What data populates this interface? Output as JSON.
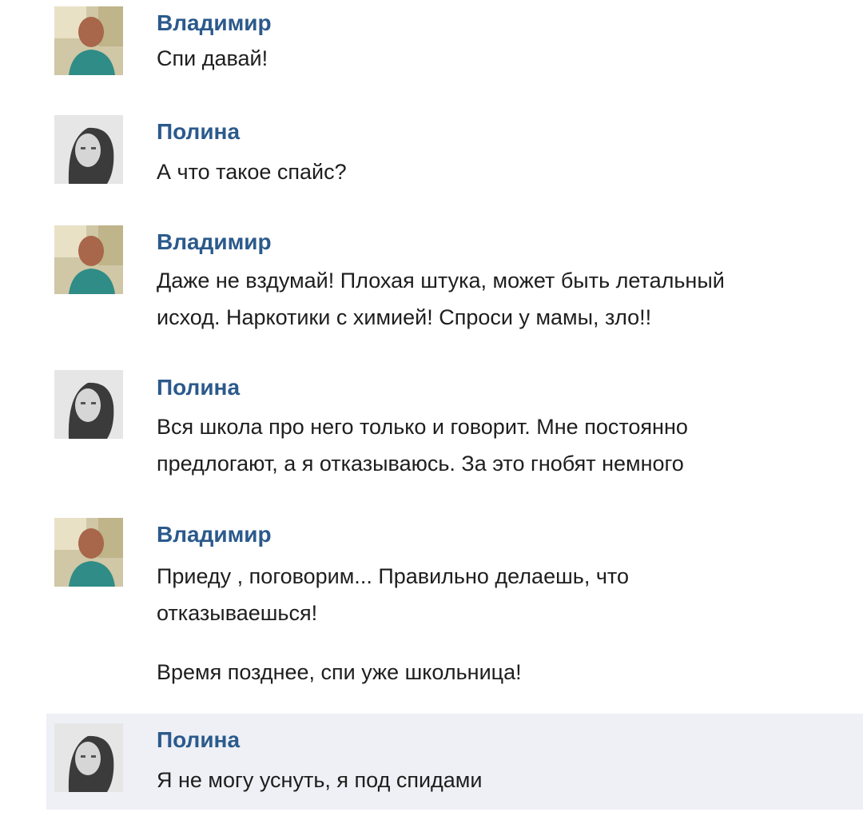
{
  "messages": [
    {
      "author": "Владимир",
      "avatar": "man-photo-avatar",
      "lines": [
        "Спи давай!"
      ]
    },
    {
      "author": "Полина",
      "avatar": "girl-photo-avatar",
      "lines": [
        "А что такое спайс?"
      ]
    },
    {
      "author": "Владимир",
      "avatar": "man-photo-avatar",
      "lines": [
        "Даже не вздумай! Плохая штука, может быть летальный",
        "исход. Наркотики с химией! Спроси у мамы, зло!!"
      ]
    },
    {
      "author": "Полина",
      "avatar": "girl-photo-avatar",
      "lines": [
        "Вся школа про него только и говорит. Мне постоянно",
        "предлогают, а я отказываюсь. За это гнобят немного"
      ]
    },
    {
      "author": "Владимир",
      "avatar": "man-photo-avatar",
      "lines": [
        "Приеду , поговорим... Правильно делаешь, что",
        "отказываешься!"
      ],
      "extra": "Время позднее, спи уже школьница!"
    },
    {
      "author": "Полина",
      "avatar": "girl-photo-avatar",
      "lines": [
        "Я не могу уснуть, я под спидами"
      ]
    }
  ],
  "colors": {
    "author": "#2b5a8c",
    "text": "#1e1e1e",
    "highlight_bg": "#eef0f5"
  }
}
